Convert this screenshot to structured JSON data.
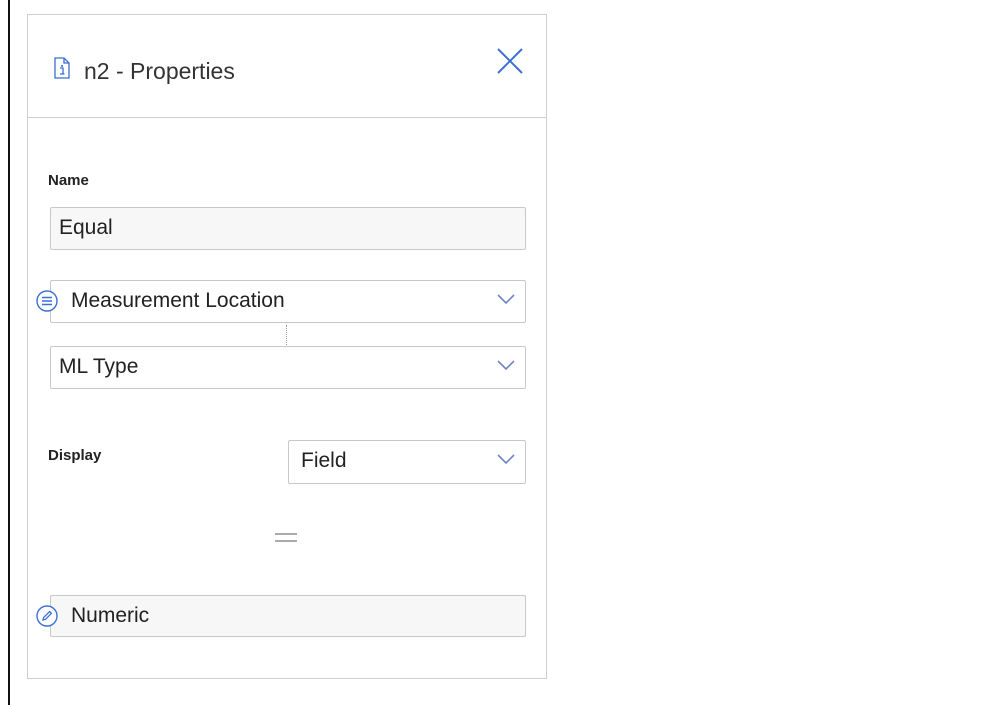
{
  "panel": {
    "title": "n2 - Properties",
    "header_icon": "info-document-icon",
    "close_icon": "close-icon"
  },
  "form": {
    "name_label": "Name",
    "name_value": "Equal",
    "entity_select": {
      "value": "Measurement Location",
      "icon": "list-circle-icon"
    },
    "field_select": {
      "value": "ML Type"
    },
    "display_label": "Display",
    "display_select": {
      "value": "Field"
    },
    "operator_icon": "equals-icon",
    "value_field": {
      "value": "Numeric",
      "icon": "pencil-circle-icon"
    }
  },
  "colors": {
    "accent": "#3b6fd4",
    "border": "#c8c8c8",
    "chevron": "#6f86c6"
  }
}
